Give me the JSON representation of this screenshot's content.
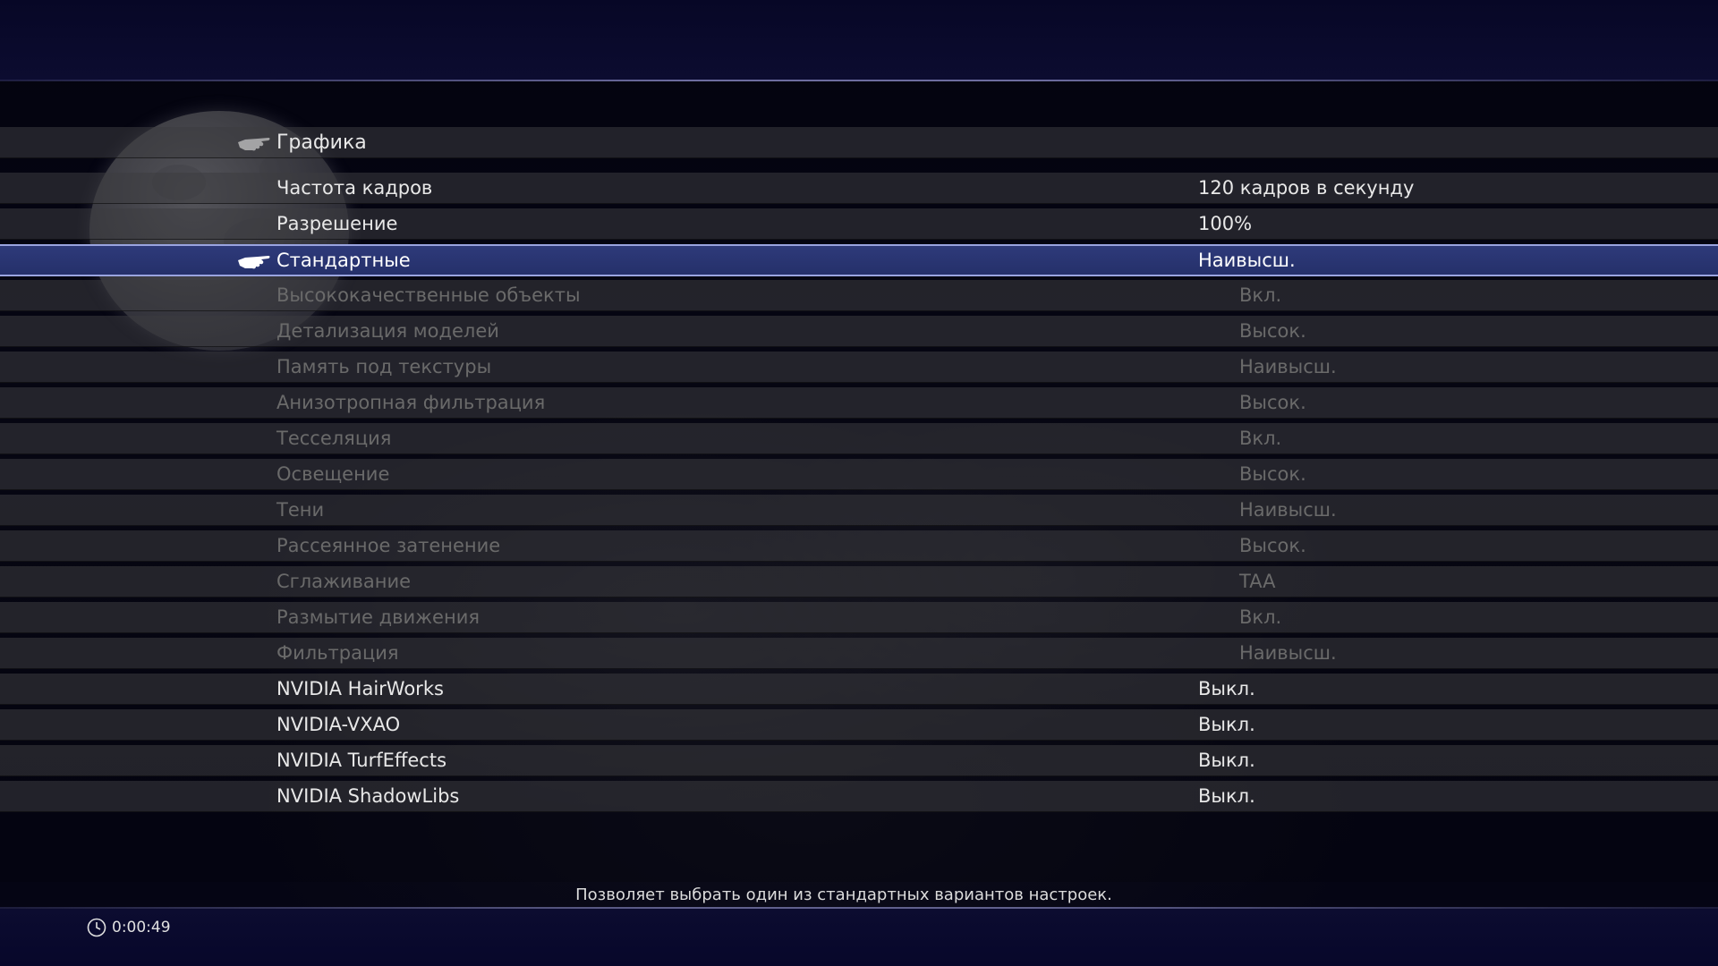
{
  "menu": {
    "section_title": "Графика",
    "settings": [
      {
        "label": "Частота кадров",
        "value": "120 кадров в секунду",
        "state": "normal"
      },
      {
        "label": "Разрешение",
        "value": "100%",
        "state": "normal"
      },
      {
        "label": "Стандартные",
        "value": "Наивысш.",
        "state": "selected"
      },
      {
        "label": "Высококачественные объекты",
        "value": "Вкл.",
        "state": "disabled"
      },
      {
        "label": "Детализация моделей",
        "value": "Высок.",
        "state": "disabled"
      },
      {
        "label": "Память под текстуры",
        "value": "Наивысш.",
        "state": "disabled"
      },
      {
        "label": "Анизотропная фильтрация",
        "value": "Высок.",
        "state": "disabled"
      },
      {
        "label": "Тесселяция",
        "value": "Вкл.",
        "state": "disabled"
      },
      {
        "label": "Освещение",
        "value": "Высок.",
        "state": "disabled"
      },
      {
        "label": "Тени",
        "value": "Наивысш.",
        "state": "disabled"
      },
      {
        "label": "Рассеянное затенение",
        "value": "Высок.",
        "state": "disabled"
      },
      {
        "label": "Сглаживание",
        "value": "TAA",
        "state": "disabled"
      },
      {
        "label": "Размытие движения",
        "value": "Вкл.",
        "state": "disabled"
      },
      {
        "label": "Фильтрация",
        "value": "Наивысш.",
        "state": "disabled"
      },
      {
        "label": "NVIDIA HairWorks",
        "value": "Выкл.",
        "state": "normal"
      },
      {
        "label": "NVIDIA-VXAO",
        "value": "Выкл.",
        "state": "normal"
      },
      {
        "label": "NVIDIA TurfEffects",
        "value": "Выкл.",
        "state": "normal"
      },
      {
        "label": "NVIDIA ShadowLibs",
        "value": "Выкл.",
        "state": "normal"
      }
    ]
  },
  "help_text": "Позволяет выбрать один из стандартных вариантов настроек.",
  "timer": "0:00:49",
  "icons": {
    "section_pointer": "hand-pointer-icon",
    "selection_pointer": "hand-pointer-icon",
    "timer": "clock-icon"
  },
  "colors": {
    "selected_row": "#2e3a7a",
    "selected_border": "#9aa4e0",
    "text_normal": "#e8e8e8",
    "text_disabled": "#6a6a6a"
  }
}
